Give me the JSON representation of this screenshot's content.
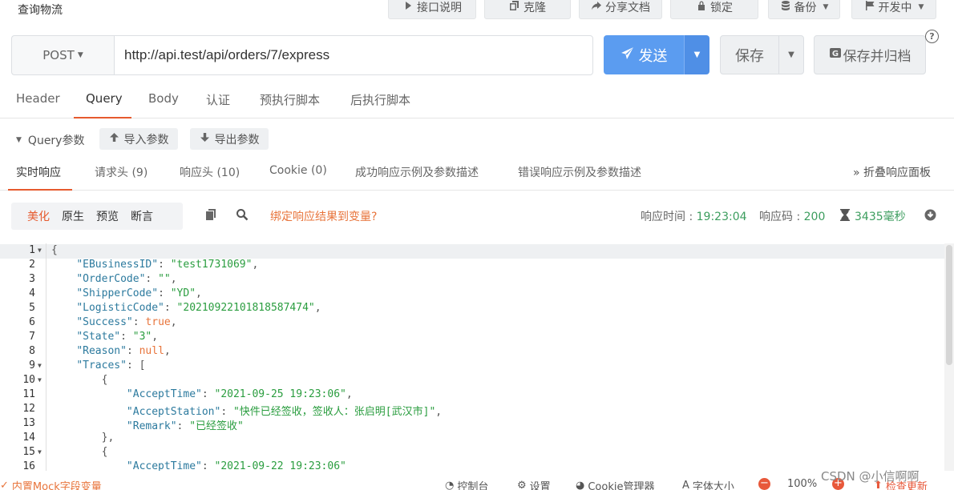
{
  "window": {
    "title": "查询物流"
  },
  "top_actions": [
    {
      "label": "接口说明",
      "icon": "play-icon"
    },
    {
      "label": "克隆",
      "icon": "copy-icon"
    },
    {
      "label": "分享文档",
      "icon": "share-icon"
    },
    {
      "label": "锁定",
      "icon": "lock-icon"
    },
    {
      "label": "备份",
      "icon": "database-icon"
    },
    {
      "label": "开发中",
      "icon": "flag-icon"
    }
  ],
  "request": {
    "method": "POST",
    "url": "http://api.test/api/orders/7/express",
    "send_label": "发送",
    "save_label": "保存",
    "save_archive_label": "保存并归档",
    "help": "?"
  },
  "request_tabs": [
    "Header",
    "Query",
    "Body",
    "认证",
    "预执行脚本",
    "后执行脚本"
  ],
  "request_tab_active": "Query",
  "query": {
    "label": "Query参数",
    "import_label": "导入参数",
    "export_label": "导出参数"
  },
  "response_tabs": [
    "实时响应",
    "请求头 (9)",
    "响应头 (10)",
    "Cookie (0)",
    "成功响应示例及参数描述",
    "错误响应示例及参数描述"
  ],
  "response_tab_active": "实时响应",
  "collapse_label": "折叠响应面板",
  "format_buttons": [
    "美化",
    "原生",
    "预览",
    "断言"
  ],
  "format_active": "美化",
  "bind_var_label": "绑定响应结果到变量?",
  "response_meta": {
    "time_label": "响应时间 : ",
    "time_value": "19:23:04",
    "code_label": "响应码 : ",
    "code_value": "200",
    "duration": "3435毫秒"
  },
  "code_lines": [
    {
      "n": "1",
      "fold": true,
      "text": "{"
    },
    {
      "n": "2",
      "text": "    \"EBusinessID\": \"test1731069\","
    },
    {
      "n": "3",
      "text": "    \"OrderCode\": \"\","
    },
    {
      "n": "4",
      "text": "    \"ShipperCode\": \"YD\","
    },
    {
      "n": "5",
      "text": "    \"LogisticCode\": \"20210922101818587474\","
    },
    {
      "n": "6",
      "text": "    \"Success\": true,"
    },
    {
      "n": "7",
      "text": "    \"State\": \"3\","
    },
    {
      "n": "8",
      "text": "    \"Reason\": null,"
    },
    {
      "n": "9",
      "fold": true,
      "text": "    \"Traces\": ["
    },
    {
      "n": "10",
      "fold": true,
      "text": "        {"
    },
    {
      "n": "11",
      "text": "            \"AcceptTime\": \"2021-09-25 19:23:06\","
    },
    {
      "n": "12",
      "text": "            \"AcceptStation\": \"快件已经签收，签收人：张启明[武汉市]\","
    },
    {
      "n": "13",
      "text": "            \"Remark\": \"已经签收\""
    },
    {
      "n": "14",
      "text": "        },"
    },
    {
      "n": "15",
      "fold": true,
      "text": "        {"
    },
    {
      "n": "16",
      "text": "            \"AcceptTime\": \"2021-09-22 19:23:06\""
    }
  ],
  "status_bar": {
    "mock_label": "内置Mock字段变量",
    "console_label": "控制台",
    "settings_label": "设置",
    "cookie_label": "Cookie管理器",
    "font_label": "字体大小",
    "zoom": "100%",
    "update_label": "检查更新"
  },
  "watermark": "CSDN @小信啊啊",
  "colors": {
    "accent": "#e65a2e",
    "send": "#5b9cf0",
    "string": "#2a9d3f",
    "keyword": "#e8743b"
  }
}
